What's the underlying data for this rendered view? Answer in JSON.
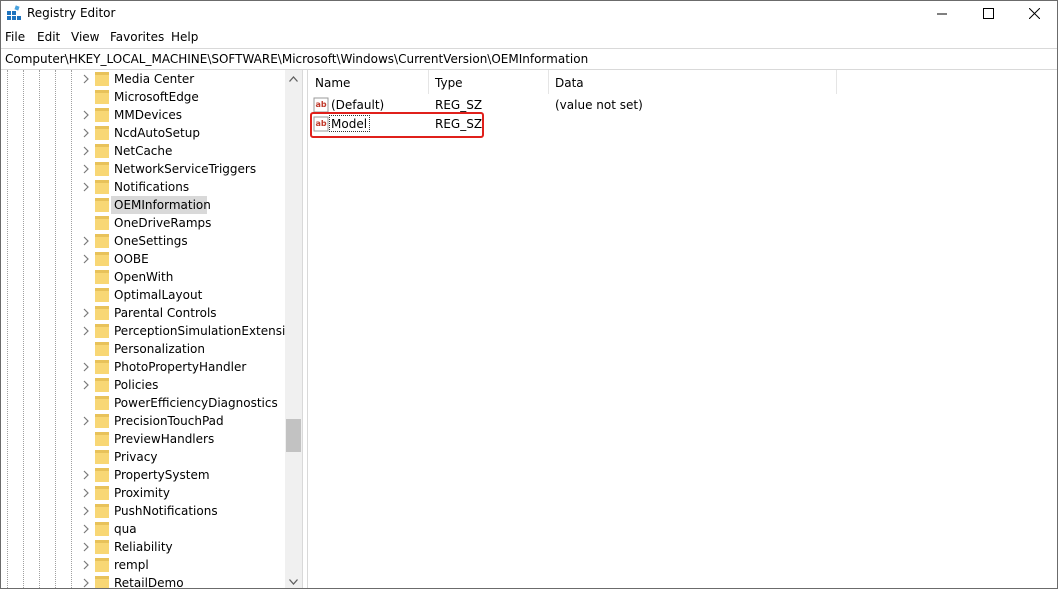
{
  "window": {
    "title": "Registry Editor",
    "icon": "registry-editor-icon"
  },
  "menu": [
    "File",
    "Edit",
    "View",
    "Favorites",
    "Help"
  ],
  "address": "Computer\\HKEY_LOCAL_MACHINE\\SOFTWARE\\Microsoft\\Windows\\CurrentVersion\\OEMInformation",
  "tree": {
    "items": [
      {
        "label": "Media Center",
        "expandable": true
      },
      {
        "label": "MicrosoftEdge",
        "expandable": false
      },
      {
        "label": "MMDevices",
        "expandable": true
      },
      {
        "label": "NcdAutoSetup",
        "expandable": true
      },
      {
        "label": "NetCache",
        "expandable": true
      },
      {
        "label": "NetworkServiceTriggers",
        "expandable": true
      },
      {
        "label": "Notifications",
        "expandable": true
      },
      {
        "label": "OEMInformation",
        "expandable": false,
        "selected": true
      },
      {
        "label": "OneDriveRamps",
        "expandable": false
      },
      {
        "label": "OneSettings",
        "expandable": true
      },
      {
        "label": "OOBE",
        "expandable": true
      },
      {
        "label": "OpenWith",
        "expandable": false
      },
      {
        "label": "OptimalLayout",
        "expandable": false
      },
      {
        "label": "Parental Controls",
        "expandable": true
      },
      {
        "label": "PerceptionSimulationExtensions",
        "expandable": true
      },
      {
        "label": "Personalization",
        "expandable": false
      },
      {
        "label": "PhotoPropertyHandler",
        "expandable": true
      },
      {
        "label": "Policies",
        "expandable": true
      },
      {
        "label": "PowerEfficiencyDiagnostics",
        "expandable": false
      },
      {
        "label": "PrecisionTouchPad",
        "expandable": true
      },
      {
        "label": "PreviewHandlers",
        "expandable": false
      },
      {
        "label": "Privacy",
        "expandable": false
      },
      {
        "label": "PropertySystem",
        "expandable": true
      },
      {
        "label": "Proximity",
        "expandable": true
      },
      {
        "label": "PushNotifications",
        "expandable": true
      },
      {
        "label": "qua",
        "expandable": true
      },
      {
        "label": "Reliability",
        "expandable": true
      },
      {
        "label": "rempl",
        "expandable": true
      },
      {
        "label": "RetailDemo",
        "expandable": true
      }
    ]
  },
  "values": {
    "columns": [
      "Name",
      "Type",
      "Data"
    ],
    "rows": [
      {
        "name": "(Default)",
        "type": "REG_SZ",
        "data": "(value not set)",
        "icon": "string-value-icon"
      },
      {
        "name": "Model",
        "type": "REG_SZ",
        "data": "",
        "icon": "string-value-icon",
        "selected": true
      }
    ]
  },
  "colors": {
    "highlight": "#e0201b",
    "folder": "#f8d775",
    "selection": "#d9d9d9"
  }
}
